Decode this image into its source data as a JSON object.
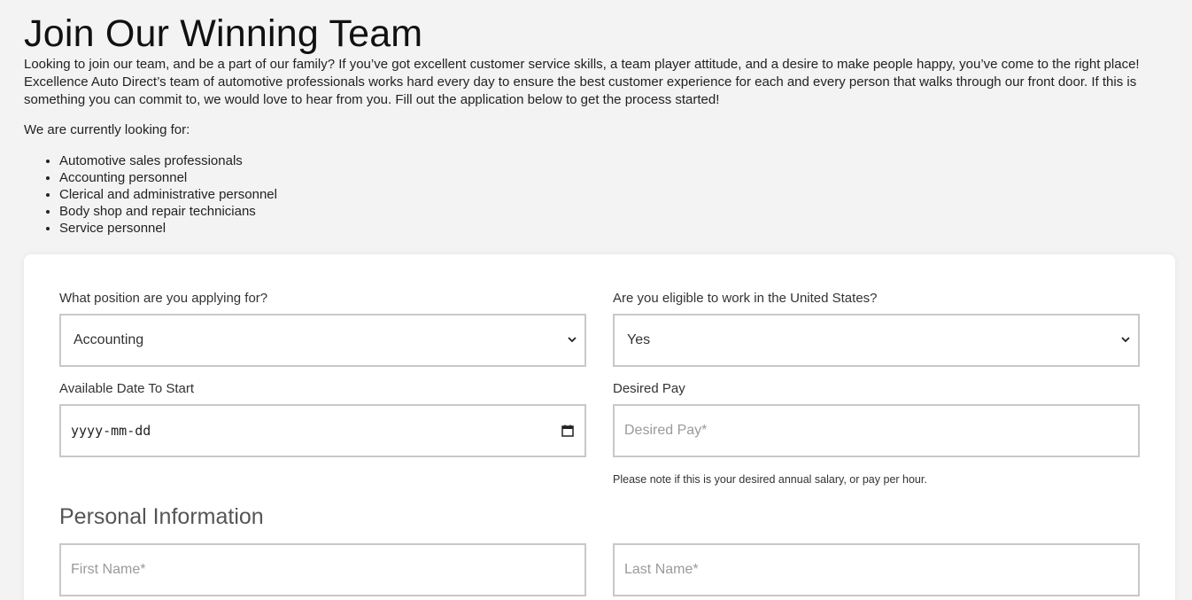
{
  "header": {
    "title": "Join Our Winning Team",
    "intro": "Looking to join our team, and be a part of our family? If you’ve got excellent customer service skills, a team player attitude, and a desire to make people happy, you’ve come to the right place! Excellence Auto Direct’s team of automotive professionals works hard every day to ensure the best customer experience for each and every person that walks through our front door. If this is something you can commit to, we would love to hear from you. Fill out the application below to get the process started!",
    "looking_for": "We are currently looking for:",
    "positions": [
      "Automotive sales professionals",
      "Accounting personnel",
      "Clerical and administrative personnel",
      "Body shop and repair technicians",
      "Service personnel"
    ]
  },
  "form": {
    "position": {
      "label": "What position are you applying for?",
      "value": "Accounting"
    },
    "eligible": {
      "label": "Are you eligible to work in the United States?",
      "value": "Yes"
    },
    "start_date": {
      "label": "Available Date To Start",
      "value": "yyyy-mm-dd"
    },
    "desired_pay": {
      "label": "Desired Pay",
      "placeholder": "Desired Pay*",
      "note": "Please note if this is your desired annual salary, or pay per hour."
    },
    "personal_section": "Personal Information",
    "first_name": {
      "placeholder": "First Name*"
    },
    "last_name": {
      "placeholder": "Last Name*"
    }
  },
  "icons": {
    "select": "chevron-down-icon",
    "date": "calendar-icon"
  }
}
